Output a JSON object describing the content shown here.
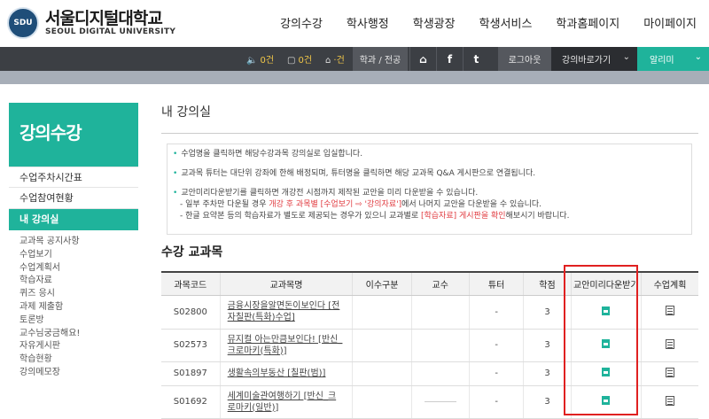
{
  "header": {
    "logo_seal": "SDU",
    "logo_kr": "서울디지털대학교",
    "logo_en": "SEOUL DIGITAL UNIVERSITY",
    "gnb": [
      "강의수강",
      "학사행정",
      "학생광장",
      "학생서비스",
      "학과홈페이지",
      "마이페이지"
    ]
  },
  "topbar": {
    "counts": [
      {
        "icon": "speaker-icon",
        "glyph": "🔈",
        "value": "0건"
      },
      {
        "icon": "chat-icon",
        "glyph": "▢",
        "value": "0건"
      },
      {
        "icon": "inbox-icon",
        "glyph": "⌂",
        "value": "·건"
      }
    ],
    "dept": "학과 / 전공",
    "home_glyph": "⌂",
    "facebook_glyph": "f",
    "twitter_glyph": "t",
    "logout": "로그아웃",
    "shortcut": "강의바로가기",
    "alert": "알리미",
    "chevron": "⌄"
  },
  "sidebar": {
    "title": "강의수강",
    "menu": [
      "수업주차시간표",
      "수업참여현황",
      "내 강의실"
    ],
    "active_index": 2,
    "submenu": [
      "교과목 공지사항",
      "수업보기",
      "수업계획서",
      "학습자료",
      "퀴즈 응시",
      "과제 제출함",
      "토론방",
      "교수님궁금해요!",
      "자유게시판",
      "학습현황",
      "강의메모장"
    ]
  },
  "main": {
    "page_title": "내 강의실",
    "notice": {
      "line1": "수업명을 클릭하면 해당수강과목 강의실로 입실합니다.",
      "line2": "교과목 튜터는 대단위 강좌에 한해 배정되며, 튜터명을 클릭하면 해당 교과목 Q&A 게시판으로 연결됩니다.",
      "line3": "교안미리다운받기를 클릭하면 개강전 시점까지 제작된 교안을 미리 다운받을 수 있습니다.",
      "line4_pre": "- 일부 주차만 다운될 경우 ",
      "line4_red": "개강 후 과목별 [수업보기 ⇨ '강의자료']",
      "line4_post": "에서 나머지 교안을 다운받을 수 있습니다.",
      "line5_pre": "- 한글 요약본 등의 학습자료가 별도로 제공되는 경우가 있으니 교과별로 ",
      "line5_red": "[학습자료] 게시판을 확인",
      "line5_post": "해보시기 바랍니다."
    },
    "section_title": "수강 교과목",
    "table": {
      "headers": [
        "과목코드",
        "교과목명",
        "이수구분",
        "교수",
        "튜터",
        "학점",
        "교안미리다운받기",
        "수업계획"
      ],
      "rows": [
        {
          "code": "S02800",
          "name": "금융시장을알면돈이보인다 [전자칠판(특화)수업]",
          "type": "",
          "prof": "",
          "tutor": "-",
          "credit": "3"
        },
        {
          "code": "S02573",
          "name": "뮤지컬 아는만큼보인다! [반신_크로마키(특화)]",
          "type": "",
          "prof": "",
          "tutor": "-",
          "credit": "3"
        },
        {
          "code": "S01897",
          "name": "생활속의부동산 [칠판(범)]",
          "type": "",
          "prof": "",
          "tutor": "-",
          "credit": "3"
        },
        {
          "code": "S01692",
          "name": "세계미술관여행하기 [반신_크로마키(일반)]",
          "type": "",
          "prof": "",
          "tutor": "-",
          "credit": "3"
        }
      ]
    }
  },
  "colors": {
    "accent": "#1fb39b",
    "dark_bar": "#3c3f44",
    "highlight": "#e02020"
  }
}
